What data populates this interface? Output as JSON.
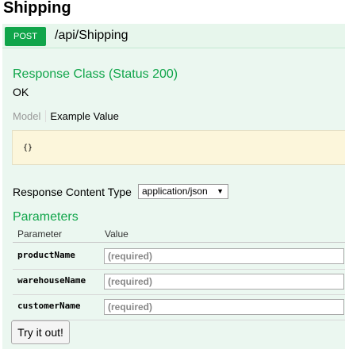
{
  "section": {
    "title": "Shipping"
  },
  "operation": {
    "method": "POST",
    "path": "/api/Shipping",
    "colors": {
      "badge": "#10a54a",
      "header_bg": "#e7f6ec",
      "body_bg": "#ebf7f0"
    }
  },
  "response": {
    "heading": "Response Class (Status 200)",
    "status_text": "OK",
    "tabs": {
      "model": "Model",
      "example": "Example Value"
    },
    "example_value": "{}"
  },
  "content_type": {
    "label": "Response Content Type",
    "selected": "application/json"
  },
  "parameters": {
    "heading": "Parameters",
    "columns": [
      "Parameter",
      "Value"
    ],
    "rows": [
      {
        "name": "productName",
        "placeholder": "(required)"
      },
      {
        "name": "warehouseName",
        "placeholder": "(required)"
      },
      {
        "name": "customerName",
        "placeholder": "(required)"
      }
    ]
  },
  "actions": {
    "try_label": "Try it out!"
  }
}
